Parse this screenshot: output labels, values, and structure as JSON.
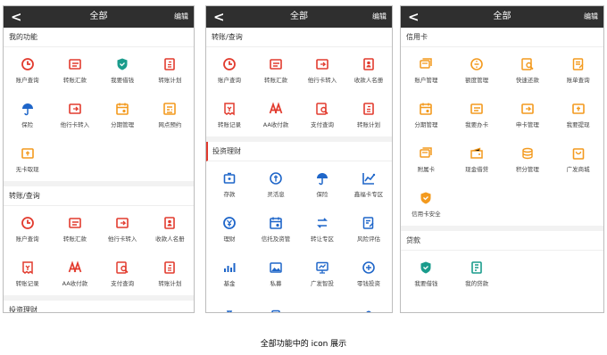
{
  "colors": {
    "red": "#e23b2e",
    "orange": "#f39a1e",
    "green": "#1a9c8c",
    "blue": "#1f66c9"
  },
  "caption": "全部功能中的 icon 展示",
  "screens": [
    {
      "title": "全部",
      "edit": "编辑",
      "back": "<",
      "sections": [
        {
          "title": "我的功能",
          "accent": false,
          "items": [
            {
              "label": "账户查询",
              "icon": "clock-icon",
              "color": "red"
            },
            {
              "label": "转账汇款",
              "icon": "transfer-icon",
              "color": "red"
            },
            {
              "label": "我要借钱",
              "icon": "shield-icon",
              "color": "green"
            },
            {
              "label": "转账计划",
              "icon": "plan-icon",
              "color": "red"
            },
            {
              "label": "保险",
              "icon": "umbrella-icon",
              "color": "blue"
            },
            {
              "label": "他行卡转入",
              "icon": "card-in-icon",
              "color": "red"
            },
            {
              "label": "分期管理",
              "icon": "calendar-icon",
              "color": "orange"
            },
            {
              "label": "网点预约",
              "icon": "bank-icon",
              "color": "orange"
            },
            {
              "label": "无卡取现",
              "icon": "cash-icon",
              "color": "orange"
            }
          ]
        },
        {
          "title": "转账/查询",
          "accent": false,
          "items": [
            {
              "label": "账户查询",
              "icon": "clock-icon",
              "color": "red"
            },
            {
              "label": "转账汇款",
              "icon": "transfer-icon",
              "color": "red"
            },
            {
              "label": "他行卡转入",
              "icon": "card-in-icon",
              "color": "red"
            },
            {
              "label": "收款人名册",
              "icon": "contacts-icon",
              "color": "red"
            },
            {
              "label": "转账记录",
              "icon": "receipt-icon",
              "color": "red"
            },
            {
              "label": "AA收付款",
              "icon": "aa-icon",
              "color": "red"
            },
            {
              "label": "支付查询",
              "icon": "search-doc-icon",
              "color": "red"
            },
            {
              "label": "转账计划",
              "icon": "plan-icon",
              "color": "red"
            }
          ]
        },
        {
          "title": "投资理财",
          "accent": false,
          "items": []
        }
      ]
    },
    {
      "title": "全部",
      "edit": "编辑",
      "back": "<",
      "sections": [
        {
          "title": "转账/查询",
          "accent": false,
          "items": [
            {
              "label": "账户查询",
              "icon": "clock-icon",
              "color": "red"
            },
            {
              "label": "转账汇款",
              "icon": "transfer-icon",
              "color": "red"
            },
            {
              "label": "他行卡转入",
              "icon": "card-in-icon",
              "color": "red"
            },
            {
              "label": "收款人名册",
              "icon": "contacts-icon",
              "color": "red"
            },
            {
              "label": "转账记录",
              "icon": "receipt-icon",
              "color": "red"
            },
            {
              "label": "AA收付款",
              "icon": "aa-icon",
              "color": "red"
            },
            {
              "label": "支付查询",
              "icon": "search-doc-icon",
              "color": "red"
            },
            {
              "label": "转账计划",
              "icon": "plan-icon",
              "color": "red"
            }
          ]
        },
        {
          "title": "投资理财",
          "accent": true,
          "items": [
            {
              "label": "存款",
              "icon": "piggy-icon",
              "color": "blue"
            },
            {
              "label": "灵活息",
              "icon": "coin-icon",
              "color": "blue"
            },
            {
              "label": "保险",
              "icon": "umbrella-icon",
              "color": "blue"
            },
            {
              "label": "鑫福卡专区",
              "icon": "chart-line-icon",
              "color": "blue"
            },
            {
              "label": "理财",
              "icon": "yen-icon",
              "color": "blue"
            },
            {
              "label": "信托及资管",
              "icon": "calendar-icon",
              "color": "blue"
            },
            {
              "label": "转让专区",
              "icon": "swap-icon",
              "color": "blue"
            },
            {
              "label": "风险评估",
              "icon": "doc-edit-icon",
              "color": "blue"
            },
            {
              "label": "基金",
              "icon": "bar-chart-icon",
              "color": "blue"
            },
            {
              "label": "私募",
              "icon": "image-icon",
              "color": "blue"
            },
            {
              "label": "广发智投",
              "icon": "monitor-icon",
              "color": "blue"
            },
            {
              "label": "零钱投资",
              "icon": "coins-icon",
              "color": "blue"
            },
            {
              "label": "",
              "icon": "money-bag-icon",
              "color": "blue"
            },
            {
              "label": "",
              "icon": "phone-icon",
              "color": "blue"
            },
            {
              "label": "",
              "icon": "vip-icon",
              "color": "blue"
            },
            {
              "label": "",
              "icon": "dots-icon",
              "color": "blue"
            }
          ]
        }
      ]
    },
    {
      "title": "全部",
      "edit": "编辑",
      "back": "<",
      "sections": [
        {
          "title": "信用卡",
          "accent": false,
          "items": [
            {
              "label": "账户管理",
              "icon": "card-stack-icon",
              "color": "orange"
            },
            {
              "label": "额度管理",
              "icon": "limit-icon",
              "color": "orange"
            },
            {
              "label": "快速还款",
              "icon": "search-doc-icon",
              "color": "orange"
            },
            {
              "label": "账单查询",
              "icon": "bill-icon",
              "color": "orange"
            },
            {
              "label": "分期管理",
              "icon": "calendar-icon",
              "color": "orange"
            },
            {
              "label": "我要办卡",
              "icon": "transfer-icon",
              "color": "orange"
            },
            {
              "label": "申卡管理",
              "icon": "card-in-icon",
              "color": "orange"
            },
            {
              "label": "我要提现",
              "icon": "cash-icon",
              "color": "orange"
            },
            {
              "label": "附属卡",
              "icon": "card-stack-icon",
              "color": "orange"
            },
            {
              "label": "现金借贷",
              "icon": "wallet-icon",
              "color": "orange"
            },
            {
              "label": "积分管理",
              "icon": "points-icon",
              "color": "orange"
            },
            {
              "label": "广发商城",
              "icon": "bag-icon",
              "color": "orange"
            },
            {
              "label": "信用卡安全",
              "icon": "shield-icon",
              "color": "orange"
            }
          ]
        },
        {
          "title": "贷款",
          "accent": false,
          "items": [
            {
              "label": "我要借钱",
              "icon": "shield-icon",
              "color": "green"
            },
            {
              "label": "我的贷款",
              "icon": "loan-doc-icon",
              "color": "green"
            }
          ]
        }
      ]
    }
  ]
}
